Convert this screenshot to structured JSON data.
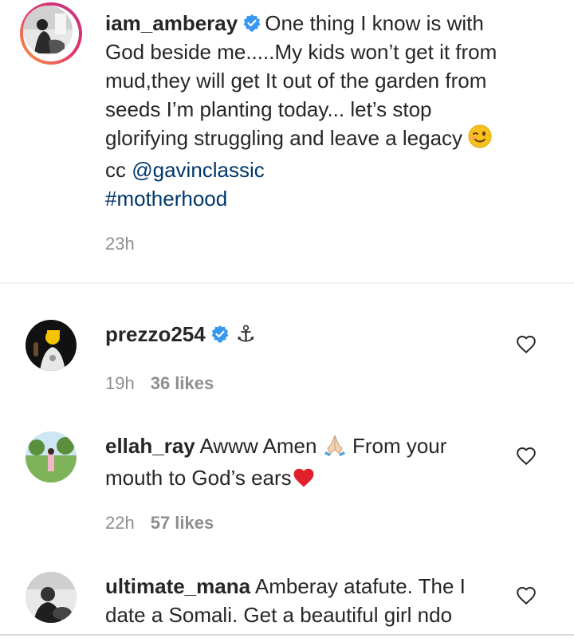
{
  "caption": {
    "username": "iam_amberay",
    "line1": "One thing I know is with",
    "line2": "God beside me.....My kids won’t get it from",
    "line3": "mud,they will get It out of the garden from",
    "line4": "seeds I’m planting today... let’s stop",
    "line5": "glorifying struggling and leave a legacy",
    "cc_prefix": "cc",
    "mention": "@gavinclassic",
    "hashtag": "#motherhood",
    "time": "23h",
    "emoji_icon": "winking-face-emoji"
  },
  "comments": [
    {
      "username": "prezzo254",
      "text": "⚓",
      "time": "19h",
      "likes": "36 likes"
    },
    {
      "username": "ellah_ray",
      "text_line1": "Awww Amen",
      "text_line1b": "From your",
      "text_line2": "mouth to God’s ears",
      "emoji_hands": "🙏🏻",
      "emoji_heart": "❤️",
      "time": "22h",
      "likes": "57 likes"
    },
    {
      "username": "ultimate_mana",
      "text_line1": "Amberay atafute. The I",
      "text_line2": "date a Somali. Get a beautiful girl ndo"
    }
  ],
  "colors": {
    "text": "#262626",
    "meta": "#8e8e8e",
    "link": "#00376b",
    "verified": "#3897f0",
    "divider": "#efefef"
  }
}
